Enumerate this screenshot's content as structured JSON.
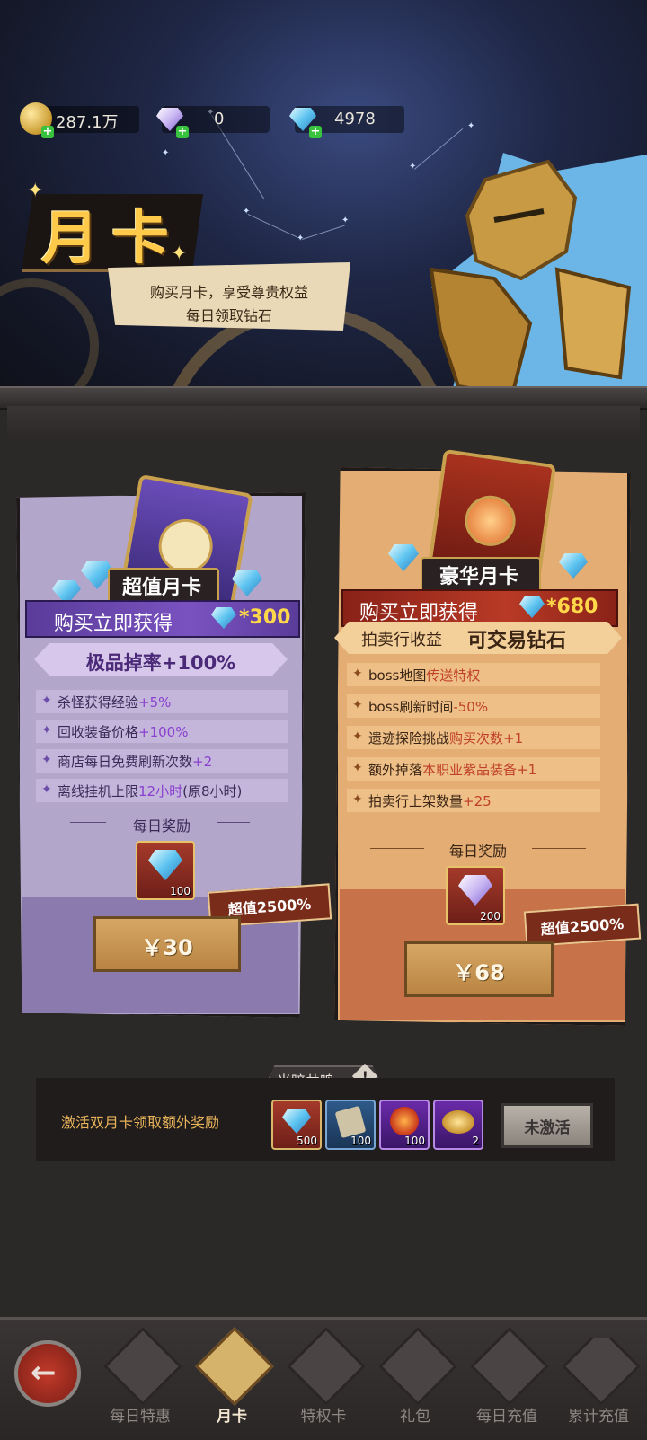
{
  "currencies": [
    {
      "name": "gold",
      "value": "287.1万"
    },
    {
      "name": "purple-diamond",
      "value": "0"
    },
    {
      "name": "blue-diamond",
      "value": "4978"
    }
  ],
  "header": {
    "title": "月卡",
    "banner_line1": "购买月卡，享受尊贵权益",
    "banner_line2": "每日领取钻石"
  },
  "cards": [
    {
      "name": "超值月卡",
      "buy_label": "购买立即获得",
      "buy_amount": "*300",
      "highlight": "极品掉率+100%",
      "benefits": [
        {
          "text": "杀怪获得经验",
          "bonus": "+5%"
        },
        {
          "text": "回收装备价格",
          "bonus": "+100%"
        },
        {
          "text": "商店每日免费刷新次数",
          "bonus": "+2"
        },
        {
          "text": "离线挂机上限",
          "bonus": "12小时",
          "suffix": "(原8小时)"
        }
      ],
      "daily_label": "每日奖励",
      "reward_amount": "100",
      "bonus_tag": "超值2500%",
      "price": "￥30"
    },
    {
      "name": "豪华月卡",
      "buy_label": "购买立即获得",
      "buy_amount": "*680",
      "highlight_a": "拍卖行收益",
      "highlight_b": "可交易钻石",
      "benefits": [
        {
          "text": "boss地图",
          "bonus": "传送特权"
        },
        {
          "text": "boss刷新时间",
          "bonus": "-50%"
        },
        {
          "text": "遗迹探险挑战",
          "bonus": "购买次数+1"
        },
        {
          "text": "额外掉落",
          "bonus": "本职业紫品装备+1"
        },
        {
          "text": "拍卖行上架数量",
          "bonus": "+25"
        }
      ],
      "daily_label": "每日奖励",
      "reward_amount": "200",
      "bonus_tag": "超值2500%",
      "price": "￥68"
    }
  ],
  "dual_card": {
    "title": "光暗共鸣",
    "text": "激活双月卡领取额外奖励",
    "status_button": "未激活",
    "rewards": [
      {
        "icon": "diamond-icon",
        "amount": "500"
      },
      {
        "icon": "scroll-icon",
        "amount": "100"
      },
      {
        "icon": "fire-orb-icon",
        "amount": "100"
      },
      {
        "icon": "gold-coins-icon",
        "amount": "2"
      }
    ]
  },
  "tabs": [
    "每日特惠",
    "月卡",
    "特权卡",
    "礼包",
    "每日充值",
    "累计充值"
  ],
  "colors": {
    "accent_gold": "#ffc94a",
    "purple_card": "#b7a8cf",
    "orange_card": "#e0a66e",
    "bonus_purple": "#8a3fd0",
    "bonus_red": "#c0412a"
  }
}
